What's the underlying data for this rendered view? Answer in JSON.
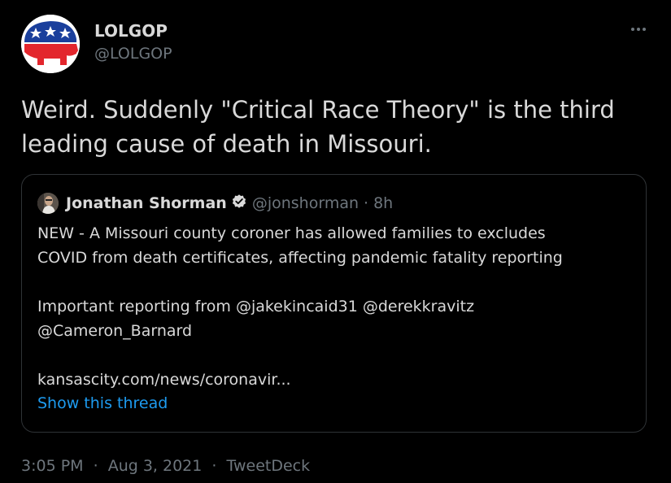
{
  "tweet": {
    "author_name": "LOLGOP",
    "author_handle": "@LOLGOP",
    "avatar_icon": "republican-elephant-icon",
    "more_icon": "more-dots-icon",
    "text_line1": "Weird. Suddenly \"Critical Race Theory\" is the third",
    "text_line2": "leading cause of death in Missouri.",
    "time": "3:05 PM",
    "separator": "·",
    "date": "Aug 3, 2021",
    "source": "TweetDeck"
  },
  "quote": {
    "author_name": "Jonathan Shorman",
    "verified_icon": "verified-badge-icon",
    "author_handle": "@jonshorman",
    "separator": "·",
    "time": "8h",
    "line1": "NEW - A Missouri county coroner has allowed families to excludes",
    "line2": "COVID from death certificates, affecting pandemic fatality reporting",
    "line3": "Important reporting from @jakekincaid31 @derekkravitz",
    "line4": "@Cameron_Barnard",
    "line5": "kansascity.com/news/coronavir...",
    "show_thread": "Show this thread"
  },
  "colors": {
    "background": "#000000",
    "text": "#d9d9d9",
    "secondary": "#6e767d",
    "link": "#1d9bf0",
    "border": "#2f3336",
    "verified": "#d9d9d9"
  }
}
